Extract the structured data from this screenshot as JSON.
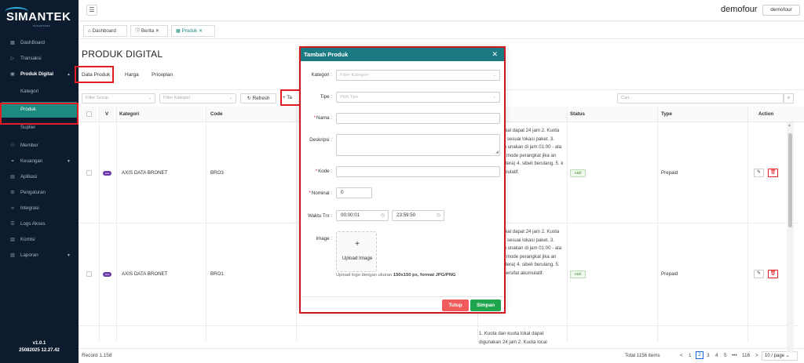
{
  "brand": {
    "name": "SIMANTEK",
    "tagline": "NUSANTARA"
  },
  "sidebar": {
    "items": [
      {
        "label": "DashBoard",
        "icon": "grid-icon"
      },
      {
        "label": "Transaksi",
        "icon": "play-circle-icon"
      },
      {
        "label": "Produk Digital",
        "icon": "box-icon"
      },
      {
        "label": "Kategori"
      },
      {
        "label": "Produk"
      },
      {
        "label": "Suplier"
      },
      {
        "label": "Member",
        "icon": "users-icon"
      },
      {
        "label": "Keuangan",
        "icon": "wallet-icon"
      },
      {
        "label": "Aplikasi",
        "icon": "app-icon"
      },
      {
        "label": "Pengaturan",
        "icon": "gear-icon"
      },
      {
        "label": "Integrasi",
        "icon": "link-icon"
      },
      {
        "label": "Logs Akses",
        "icon": "log-icon"
      },
      {
        "label": "Komisi",
        "icon": "percent-icon"
      },
      {
        "label": "Laporan",
        "icon": "report-icon"
      }
    ],
    "version": "v1.0.1",
    "build": "25082025 12.27.42"
  },
  "topbar": {
    "username": "demofour",
    "user_button": "demofour"
  },
  "tabs": [
    {
      "label": "Dashboard"
    },
    {
      "label": "Berita"
    },
    {
      "label": "Produk"
    }
  ],
  "page": {
    "title": "PRODUK DIGITAL",
    "subtabs": [
      "Data Produk",
      "Harga",
      "Priceplan"
    ],
    "filters": {
      "group_placeholder": "Filter Group",
      "kategori_placeholder": "Filter Kategori",
      "refresh_label": "Refresh",
      "add_label": "+ Ta",
      "search_placeholder": "Cari..."
    },
    "table": {
      "headers": [
        "V",
        "Kategori",
        "Code",
        "n",
        "Status",
        "Type",
        "Action"
      ],
      "rows": [
        {
          "operator": "axis",
          "kategori": "AXIS DATA BRONET",
          "code": "BRO3",
          "desc": "nan kuota lokal dapat 24 jam 2. Kuota local unakan sesuai lokasi paket. 3. kuota malam unakan di jam 01:00 - ala dan matikan mode perangkat jika an pada jam tertera) 4. sibeli berulang. 5. k bersifat akumulatif.",
          "status": "Aktif",
          "type": "Prepaid"
        },
        {
          "operator": "axis",
          "kategori": "AXIS DATA BRONET",
          "code": "BRO1",
          "desc": "nan kuota lokal dapat 24 jam 2. Kuota local unakan sesuai lokasi paket. 3. kuota malam unakan di jam 01:00 - ala dan matikan mode perangkat jika an pada jam tertera) 4. sibeli berulang. 5. kuota tidak bersifat akumulatif.",
          "status": "Aktif",
          "type": "Prepaid"
        }
      ],
      "partial_desc": "1. Kuota dan kuota lokal dapat digunakan 24 jam 2. Kuota local"
    },
    "footer": {
      "record": "Record 1.158",
      "total": "Total 1156 items",
      "pages": [
        "<",
        "1",
        "2",
        "3",
        "4",
        "5",
        "•••",
        "116",
        ">"
      ],
      "current_page": "2",
      "per_page": "10 / page"
    }
  },
  "modal": {
    "title": "Tambah Produk",
    "fields": {
      "kategori_label": "Kategori :",
      "kategori_placeholder": "Filter Kategori",
      "tipe_label": "Tipe :",
      "tipe_placeholder": "Pilih Tipe",
      "nama_label": "Nama :",
      "deskripsi_label": "Deskripsi :",
      "kode_label": "Kode :",
      "nominal_label": "Nominal :",
      "nominal_value": "0",
      "waktu_label": "Waktu Trx :",
      "waktu_start": "00:00:01",
      "waktu_end": "23:59:50",
      "image_label": "Image :",
      "upload_label": "Upload Image",
      "hint_prefix": "Upload logo dengan ukuran",
      "hint_size": "150x150 px, format JPG/PNG"
    },
    "buttons": {
      "close": "Tutup",
      "save": "Simpan"
    }
  },
  "colors": {
    "sidebar_bg": "#0d1b2e",
    "accent_teal": "#1c8a7e",
    "modal_header": "#1b7a82",
    "highlight_red": "#e31b23",
    "save_green": "#1fa54e",
    "close_red": "#f15b5b"
  }
}
